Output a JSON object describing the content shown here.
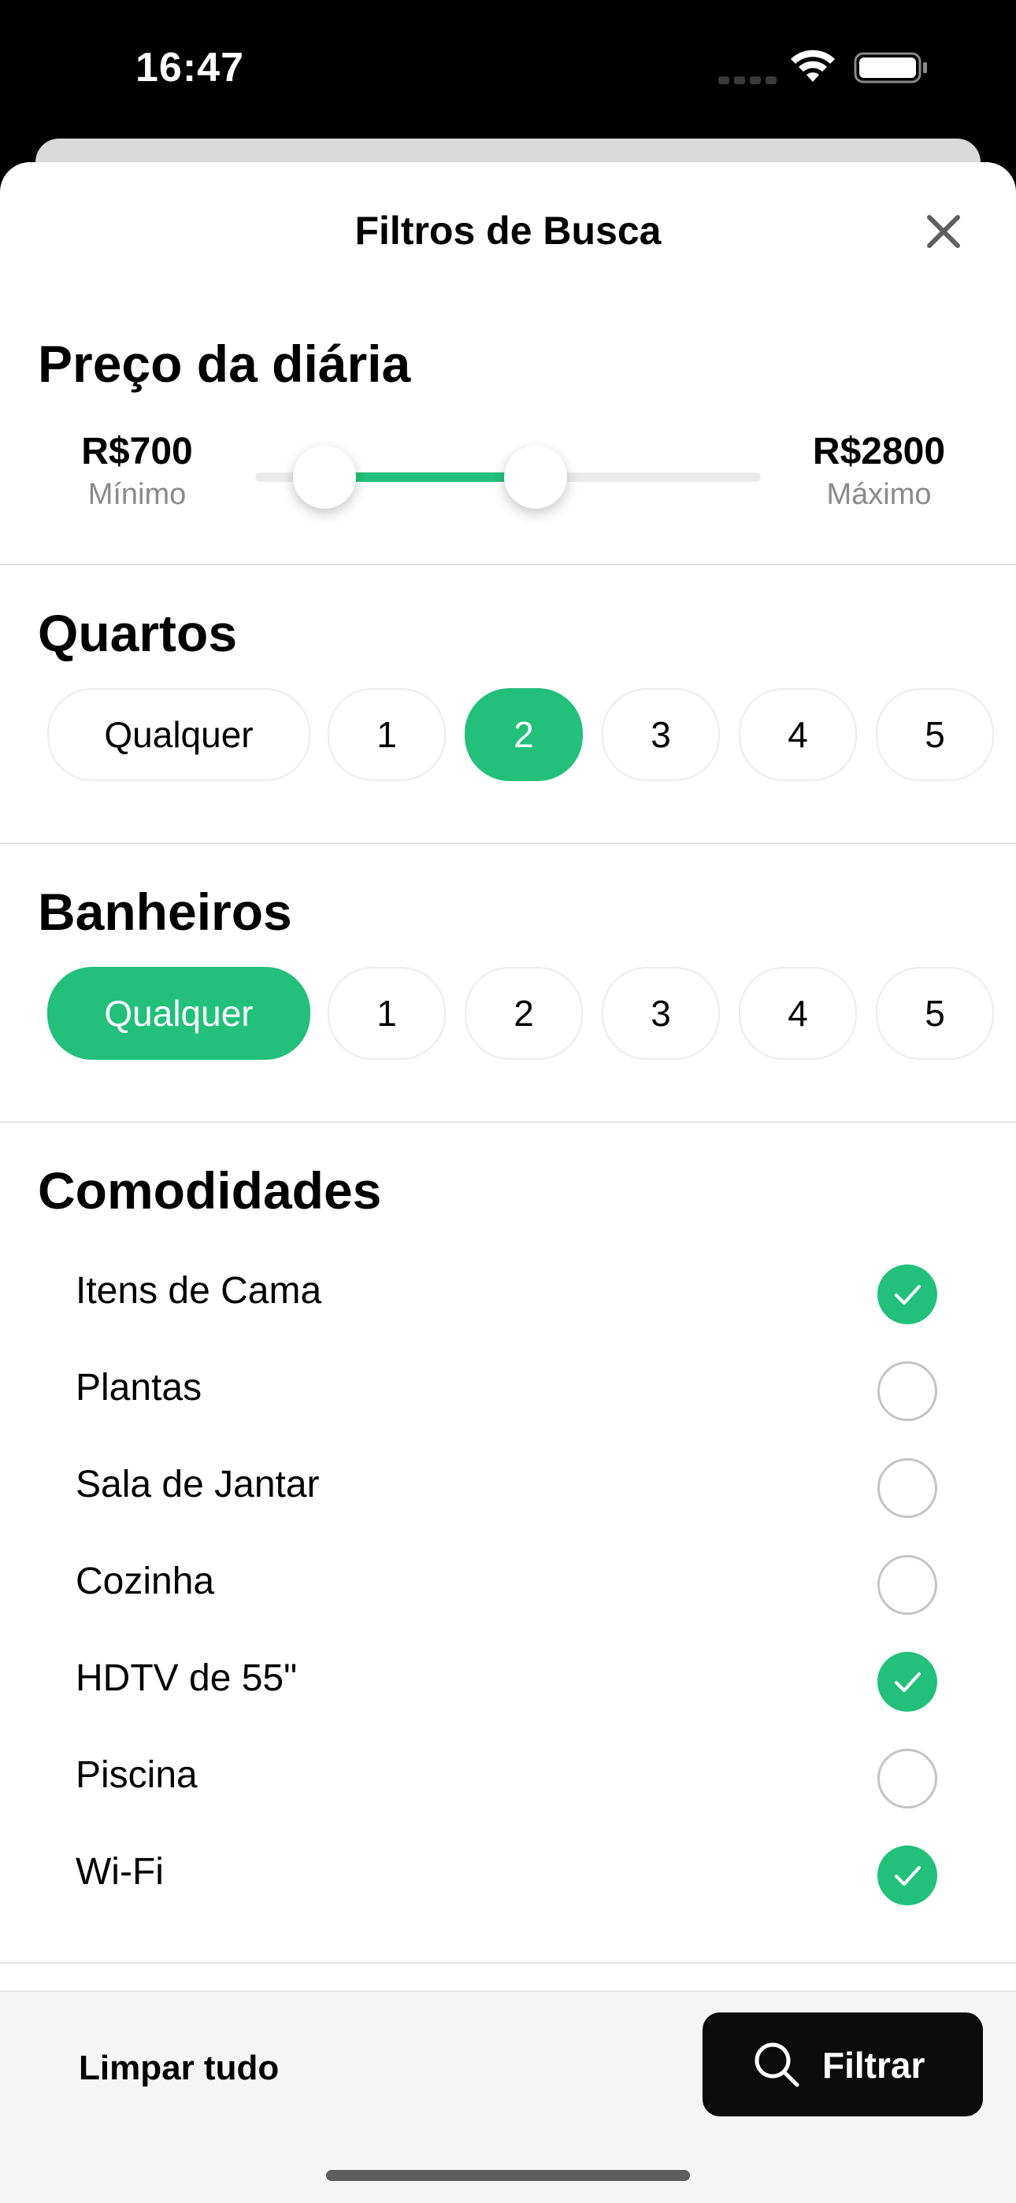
{
  "status": {
    "time": "16:47"
  },
  "header": {
    "title": "Filtros de Busca",
    "close_icon": "close-icon"
  },
  "price": {
    "title": "Preço da diária",
    "min_value": "R$700",
    "min_caption": "Mínimo",
    "max_value": "R$2800",
    "max_caption": "Máximo"
  },
  "bedrooms": {
    "title": "Quartos",
    "options": [
      "Qualquer",
      "1",
      "2",
      "3",
      "4",
      "5"
    ],
    "selected": "2"
  },
  "bathrooms": {
    "title": "Banheiros",
    "options": [
      "Qualquer",
      "1",
      "2",
      "3",
      "4",
      "5"
    ],
    "selected": "Qualquer"
  },
  "amenities": {
    "title": "Comodidades",
    "items": [
      {
        "label": "Itens de Cama",
        "checked": true
      },
      {
        "label": "Plantas",
        "checked": false
      },
      {
        "label": "Sala de Jantar",
        "checked": false
      },
      {
        "label": "Cozinha",
        "checked": false
      },
      {
        "label": "HDTV de 55\"",
        "checked": true
      },
      {
        "label": "Piscina",
        "checked": false
      },
      {
        "label": "Wi-Fi",
        "checked": true
      }
    ]
  },
  "footer": {
    "clear_label": "Limpar tudo",
    "filter_label": "Filtrar",
    "filter_icon": "search-icon"
  },
  "colors": {
    "accent": "#22c07a",
    "primary_button": "#0c0c0c"
  }
}
